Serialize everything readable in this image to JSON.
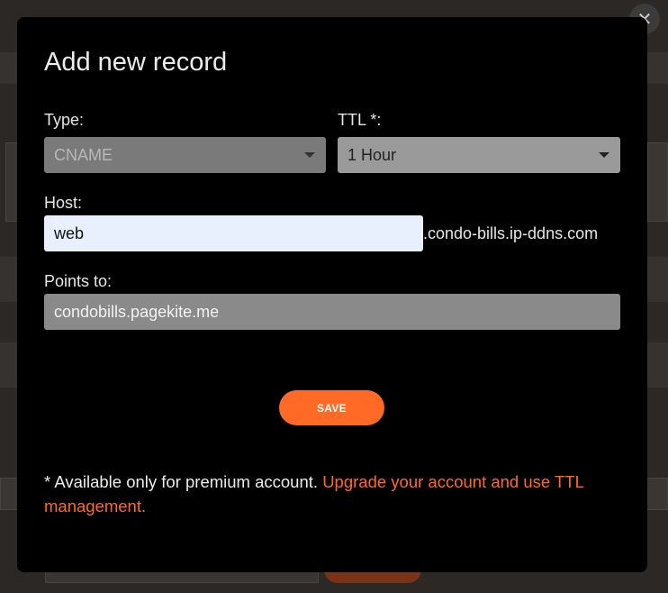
{
  "modal": {
    "title": "Add new record",
    "type_label": "Type:",
    "type_value": "CNAME",
    "ttl_label": "TTL *:",
    "ttl_value": "1 Hour",
    "host_label": "Host:",
    "host_value": "web",
    "host_suffix": ".condo-bills.ip-ddns.com",
    "points_label": "Points to:",
    "points_value": "condobills.pagekite.me",
    "save_label": "SAVE",
    "note_text": "* Available only for premium account. ",
    "note_link": "Upgrade your account and use TTL management."
  },
  "icons": {
    "close": "close-icon",
    "caret": "chevron-down-icon"
  },
  "colors": {
    "accent": "#ff6a26",
    "modal_bg": "#000000",
    "host_input_bg": "#e8f0fe"
  }
}
